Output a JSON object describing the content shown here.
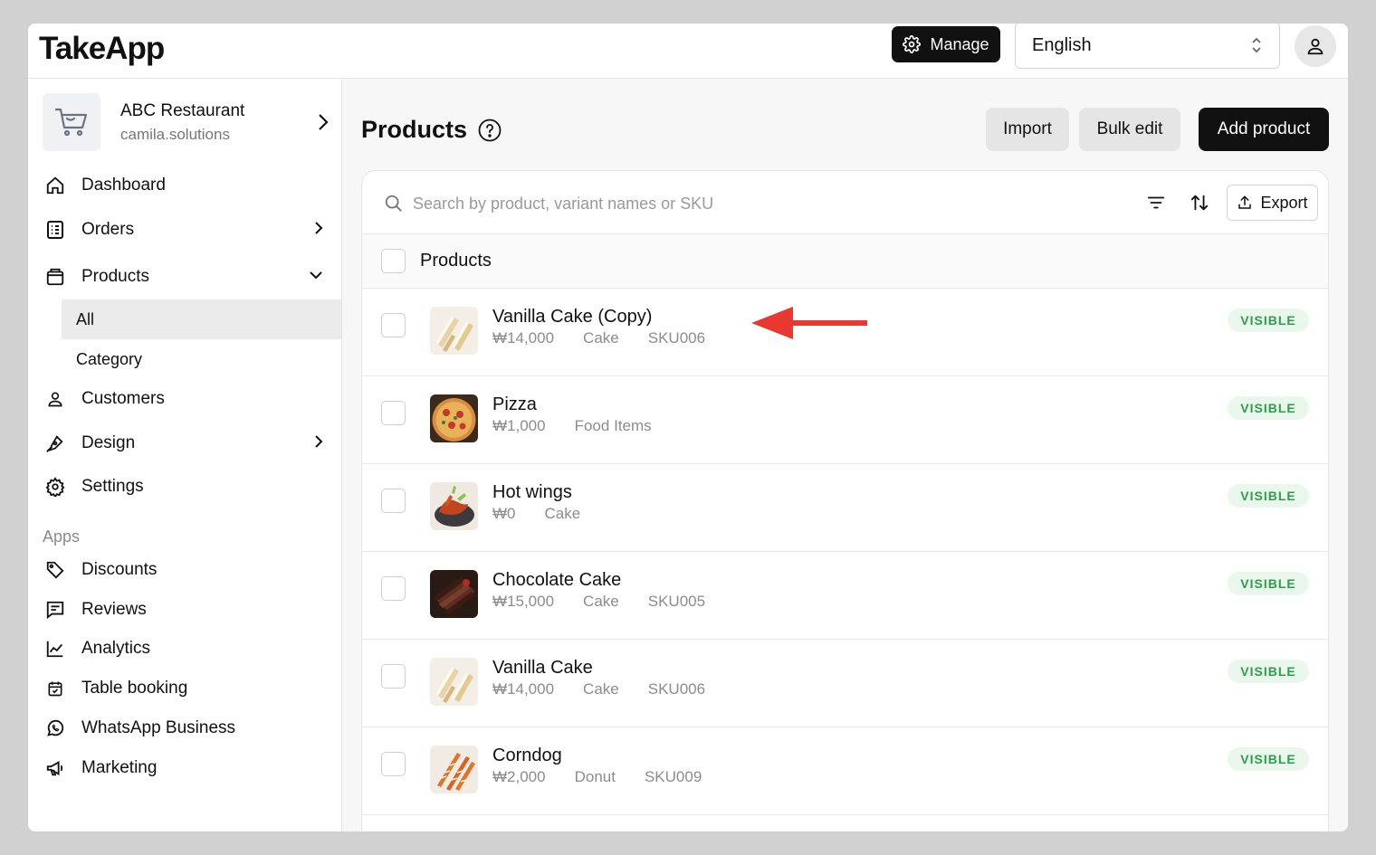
{
  "app": {
    "logo": "TakeApp"
  },
  "topbar": {
    "manage_label": "Manage",
    "language": "English"
  },
  "store": {
    "name": "ABC Restaurant",
    "domain": "camila.solutions"
  },
  "nav": {
    "dashboard": "Dashboard",
    "orders": "Orders",
    "products": "Products",
    "sub_all": "All",
    "sub_category": "Category",
    "customers": "Customers",
    "design": "Design",
    "settings": "Settings",
    "apps_label": "Apps",
    "discounts": "Discounts",
    "reviews": "Reviews",
    "analytics": "Analytics",
    "table_booking": "Table booking",
    "whatsapp": "WhatsApp Business",
    "marketing": "Marketing"
  },
  "main": {
    "title": "Products",
    "import_label": "Import",
    "bulk_edit_label": "Bulk edit",
    "add_product_label": "Add product",
    "search_placeholder": "Search by product, variant names or SKU",
    "export_label": "Export",
    "table_header": "Products"
  },
  "products": [
    {
      "name": "Vanilla Cake (Copy)",
      "price": "₩14,000",
      "category": "Cake",
      "sku": "SKU006",
      "status": "VISIBLE"
    },
    {
      "name": "Pizza",
      "price": "₩1,000",
      "category": "Food Items",
      "sku": "",
      "status": "VISIBLE"
    },
    {
      "name": "Hot wings",
      "price": "₩0",
      "category": "Cake",
      "sku": "",
      "status": "VISIBLE"
    },
    {
      "name": "Chocolate Cake",
      "price": "₩15,000",
      "category": "Cake",
      "sku": "SKU005",
      "status": "VISIBLE"
    },
    {
      "name": "Vanilla Cake",
      "price": "₩14,000",
      "category": "Cake",
      "sku": "SKU006",
      "status": "VISIBLE"
    },
    {
      "name": "Corndog",
      "price": "₩2,000",
      "category": "Donut",
      "sku": "SKU009",
      "status": "VISIBLE"
    }
  ],
  "colors": {
    "accent_dark": "#111111",
    "visible_badge": "#2e9e4a",
    "annotation_arrow": "#e8382f"
  }
}
